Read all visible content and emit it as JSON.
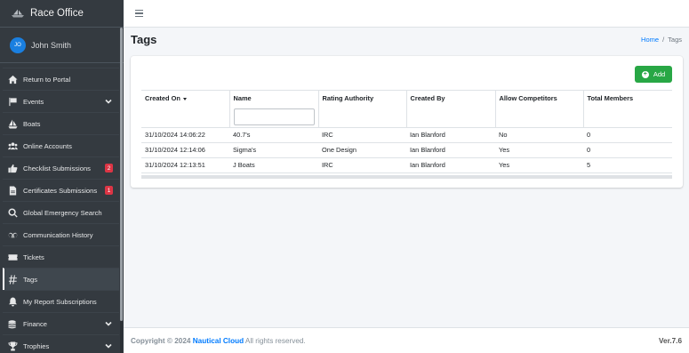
{
  "app": {
    "title": "Race Office"
  },
  "user": {
    "initials": "JO",
    "name": "John Smith"
  },
  "sidebar": {
    "items": [
      {
        "label": "Return to Portal",
        "icon": "home-icon"
      },
      {
        "label": "Events",
        "icon": "flag-icon",
        "chevron": true
      },
      {
        "label": "Boats",
        "icon": "sailboat-icon"
      },
      {
        "label": "Online Accounts",
        "icon": "users-icon"
      },
      {
        "label": "Checklist Submissions",
        "icon": "thumbs-up-icon",
        "badge": "2"
      },
      {
        "label": "Certificates Submissions",
        "icon": "file-icon",
        "badge": "1"
      },
      {
        "label": "Global Emergency Search",
        "icon": "search-icon"
      },
      {
        "label": "Communication History",
        "icon": "voicemail-icon"
      },
      {
        "label": "Tickets",
        "icon": "ticket-icon"
      },
      {
        "label": "Tags",
        "icon": "hashtag-icon",
        "active": true
      },
      {
        "label": "My Report Subscriptions",
        "icon": "bell-icon"
      },
      {
        "label": "Finance",
        "icon": "coins-icon",
        "chevron": true
      },
      {
        "label": "Trophies",
        "icon": "trophy-icon",
        "chevron": true
      }
    ]
  },
  "page": {
    "title": "Tags"
  },
  "breadcrumb": {
    "home": "Home",
    "separator": "/",
    "current": "Tags"
  },
  "toolbar": {
    "add_label": "Add"
  },
  "table": {
    "columns": [
      "Created On",
      "Name",
      "Rating Authority",
      "Created By",
      "Allow Competitors",
      "Total Members"
    ],
    "sorted_column": "Created On",
    "name_filter_value": "",
    "rows": [
      [
        "31/10/2024 14:06:22",
        "40.7's",
        "IRC",
        "Ian Blanford",
        "No",
        "0"
      ],
      [
        "31/10/2024 12:14:06",
        "Sigma's",
        "One Design",
        "Ian Blanford",
        "Yes",
        "0"
      ],
      [
        "31/10/2024 12:13:51",
        "J Boats",
        "IRC",
        "Ian Blanford",
        "Yes",
        "5"
      ]
    ]
  },
  "footer": {
    "copyright_prefix": "Copyright © 2024",
    "company": "Nautical Cloud",
    "rights": "All rights reserved.",
    "version": "Ver.7.6"
  },
  "colors": {
    "sidebar_bg": "#343a40",
    "accent_blue": "#007bff",
    "add_green": "#28a745",
    "badge_red": "#dc3545",
    "avatar_blue": "#1a7fe0"
  }
}
